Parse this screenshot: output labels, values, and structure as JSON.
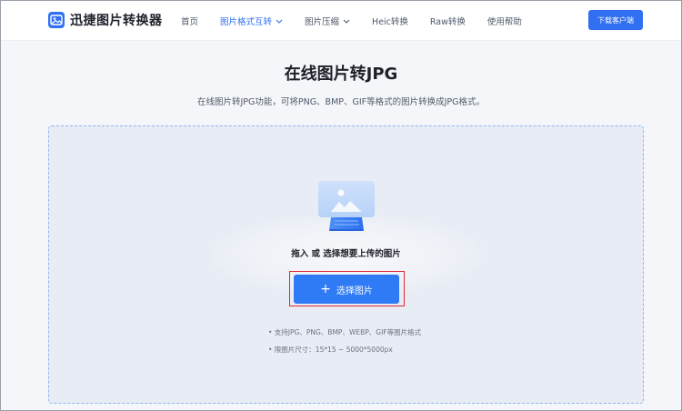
{
  "header": {
    "logo_text": "迅捷图片转换器",
    "nav": [
      {
        "label": "首页",
        "active": false
      },
      {
        "label": "图片格式互转",
        "active": true,
        "dropdown": true
      },
      {
        "label": "图片压缩",
        "active": false,
        "dropdown": true
      },
      {
        "label": "Heic转换",
        "active": false
      },
      {
        "label": "Raw转换",
        "active": false
      },
      {
        "label": "使用帮助",
        "active": false
      }
    ],
    "download_button": "下载客户端"
  },
  "main": {
    "title": "在线图片转JPG",
    "subtitle": "在线图片转JPG功能，可将PNG、BMP、GIF等格式的图片转换成JPG格式。"
  },
  "upload": {
    "prompt": "拖入 或 选择想要上传的图片",
    "button_icon": "plus-icon",
    "button_label": "选择图片",
    "hints": [
      "• 支持JPG、PNG、BMP、WEBP、GIF等图片格式",
      "• 限图片尺寸：15*15 ~ 5000*5000px"
    ]
  },
  "colors": {
    "brand": "#2f6ff0",
    "highlight_border": "#e0282e",
    "dropzone_bg": "#e8ecf4",
    "dropzone_border": "#8db6f2"
  }
}
